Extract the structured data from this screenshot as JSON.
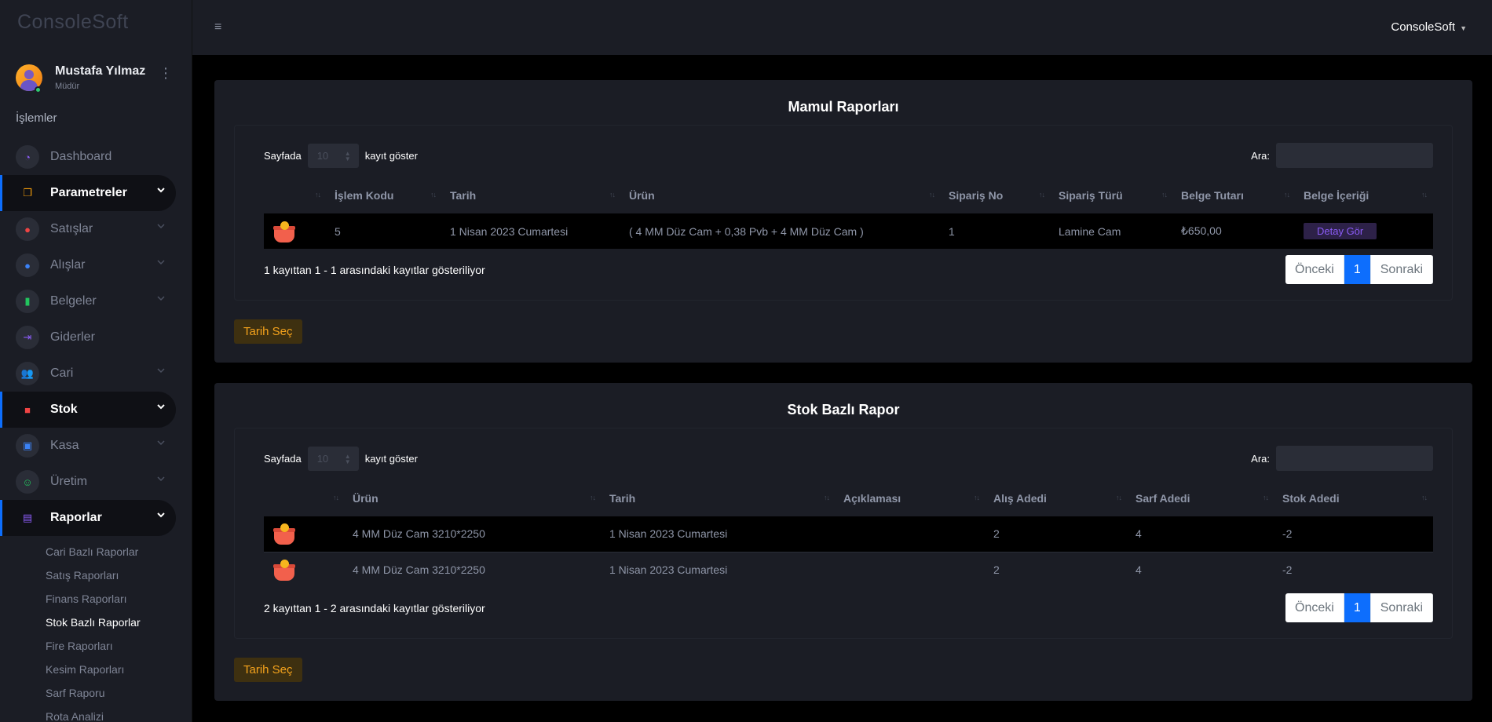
{
  "brand": "ConsoleSoft",
  "user": {
    "name": "Mustafa Yılmaz",
    "role": "Müdür"
  },
  "sidebar": {
    "section": "İşlemler",
    "items": [
      {
        "label": "Dashboard",
        "icon": "gauge-icon",
        "color": "#8b5cf6"
      },
      {
        "label": "Parametreler",
        "icon": "copy-icon",
        "color": "#f59e0b"
      },
      {
        "label": "Satışlar",
        "icon": "play-circle-icon",
        "color": "#ef4444"
      },
      {
        "label": "Alışlar",
        "icon": "minus-circle-icon",
        "color": "#3b82f6"
      },
      {
        "label": "Belgeler",
        "icon": "book-icon",
        "color": "#22c55e"
      },
      {
        "label": "Giderler",
        "icon": "arrow-right-to-bar-icon",
        "color": "#8b5cf6"
      },
      {
        "label": "Cari",
        "icon": "users-icon",
        "color": "#f59e0b"
      },
      {
        "label": "Stok",
        "icon": "layers-icon",
        "color": "#ef4444"
      },
      {
        "label": "Kasa",
        "icon": "cash-register-icon",
        "color": "#3b82f6"
      },
      {
        "label": "Üretim",
        "icon": "robot-icon",
        "color": "#22c55e"
      },
      {
        "label": "Raporlar",
        "icon": "clipboard-icon",
        "color": "#8b5cf6"
      }
    ],
    "subitems": [
      "Cari Bazlı Raporlar",
      "Satış Raporları",
      "Finans Raporları",
      "Stok Bazlı Raporlar",
      "Fire Raporları",
      "Kesim Raporları",
      "Sarf Raporu",
      "Rota Analizi"
    ]
  },
  "topbar": {
    "user": "ConsoleSoft"
  },
  "mamul": {
    "title": "Mamul Raporları",
    "show_prefix": "Sayfada",
    "show_value": "10",
    "show_suffix": "kayıt göster",
    "search_label": "Ara:",
    "columns": [
      "İşlem Kodu",
      "Tarih",
      "Ürün",
      "Sipariş No",
      "Sipariş Türü",
      "Belge Tutarı",
      "Belge İçeriği"
    ],
    "rows": [
      {
        "code": "5",
        "date": "1 Nisan 2023 Cumartesi",
        "product": "( 4 MM Düz Cam + 0,38 Pvb + 4 MM Düz Cam )",
        "order_no": "1",
        "order_type": "Lamine Cam",
        "amount": "₺650,00",
        "action": "Detay Gör"
      }
    ],
    "info": "1 kayıttan 1 - 1 arasındaki kayıtlar gösteriliyor",
    "prev": "Önceki",
    "page": "1",
    "next": "Sonraki",
    "date_button": "Tarih Seç"
  },
  "stok": {
    "title": "Stok Bazlı Rapor",
    "show_prefix": "Sayfada",
    "show_value": "10",
    "show_suffix": "kayıt göster",
    "search_label": "Ara:",
    "columns": [
      "Ürün",
      "Tarih",
      "Açıklaması",
      "Alış Adedi",
      "Sarf Adedi",
      "Stok Adedi"
    ],
    "rows": [
      {
        "product": "4 MM Düz Cam 3210*2250",
        "date": "1 Nisan 2023 Cumartesi",
        "desc": "",
        "buy": "2",
        "use": "4",
        "stock": "-2"
      },
      {
        "product": "4 MM Düz Cam 3210*2250",
        "date": "1 Nisan 2023 Cumartesi",
        "desc": "",
        "buy": "2",
        "use": "4",
        "stock": "-2"
      }
    ],
    "info": "2 kayıttan 1 - 2 arasındaki kayıtlar gösteriliyor",
    "prev": "Önceki",
    "page": "1",
    "next": "Sonraki",
    "date_button": "Tarih Seç"
  }
}
